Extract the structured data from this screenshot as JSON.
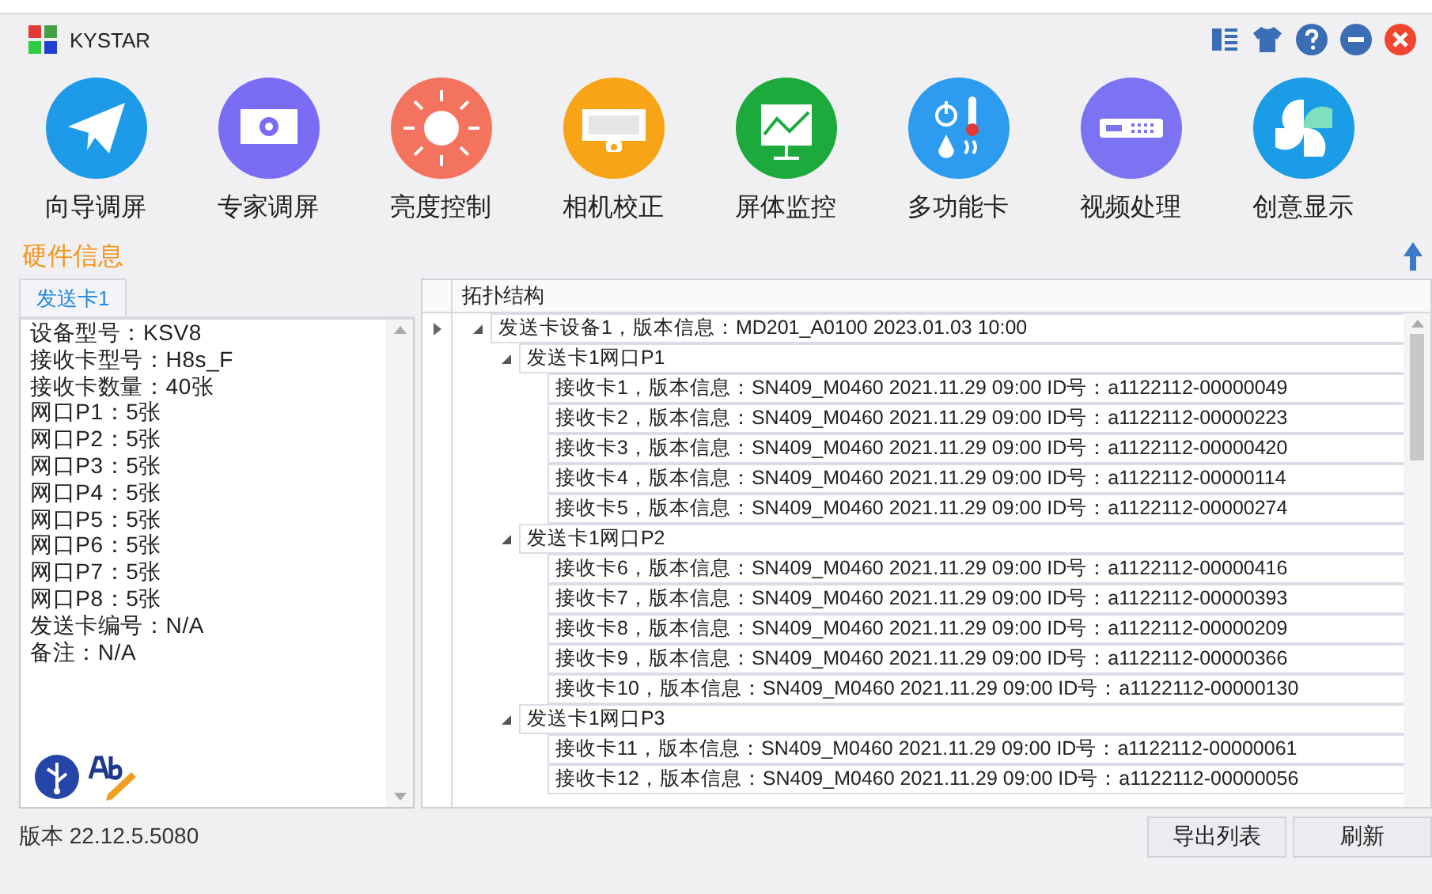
{
  "window": {
    "title": "KYSTAR"
  },
  "toolbar": [
    {
      "label": "向导调屏",
      "kind": "wizard"
    },
    {
      "label": "专家调屏",
      "kind": "expert"
    },
    {
      "label": "亮度控制",
      "kind": "brightness"
    },
    {
      "label": "相机校正",
      "kind": "camera"
    },
    {
      "label": "屏体监控",
      "kind": "monitor"
    },
    {
      "label": "多功能卡",
      "kind": "multi"
    },
    {
      "label": "视频处理",
      "kind": "video"
    },
    {
      "label": "创意显示",
      "kind": "creative"
    }
  ],
  "section_title": "硬件信息",
  "left_panel": {
    "tabs": [
      {
        "label": "发送卡1",
        "selected": true
      }
    ],
    "lines": [
      "设备型号：KSV8",
      "接收卡型号：H8s_F",
      "接收卡数量：40张",
      "网口P1：5张",
      "网口P2：5张",
      "网口P3：5张",
      "网口P4：5张",
      "网口P5：5张",
      "网口P6：5张",
      "网口P7：5张",
      "网口P8：5张",
      "发送卡编号：N/A",
      "备注：N/A"
    ]
  },
  "topology": {
    "header": "拓扑结构",
    "tree": [
      {
        "label": "发送卡设备1，版本信息：MD201_A0100 2023.01.03 10:00",
        "expanded": true,
        "children": [
          {
            "label": "发送卡1网口P1",
            "expanded": true,
            "children": [
              {
                "label": "接收卡1，版本信息：SN409_M0460 2021.11.29 09:00 ID号：a1122112-00000049"
              },
              {
                "label": "接收卡2，版本信息：SN409_M0460 2021.11.29 09:00 ID号：a1122112-00000223"
              },
              {
                "label": "接收卡3，版本信息：SN409_M0460 2021.11.29 09:00 ID号：a1122112-00000420"
              },
              {
                "label": "接收卡4，版本信息：SN409_M0460 2021.11.29 09:00 ID号：a1122112-00000114"
              },
              {
                "label": "接收卡5，版本信息：SN409_M0460 2021.11.29 09:00 ID号：a1122112-00000274"
              }
            ]
          },
          {
            "label": "发送卡1网口P2",
            "expanded": true,
            "children": [
              {
                "label": "接收卡6，版本信息：SN409_M0460 2021.11.29 09:00 ID号：a1122112-00000416"
              },
              {
                "label": "接收卡7，版本信息：SN409_M0460 2021.11.29 09:00 ID号：a1122112-00000393"
              },
              {
                "label": "接收卡8，版本信息：SN409_M0460 2021.11.29 09:00 ID号：a1122112-00000209"
              },
              {
                "label": "接收卡9，版本信息：SN409_M0460 2021.11.29 09:00 ID号：a1122112-00000366"
              },
              {
                "label": "接收卡10，版本信息：SN409_M0460 2021.11.29 09:00 ID号：a1122112-00000130"
              }
            ]
          },
          {
            "label": "发送卡1网口P3",
            "expanded": true,
            "children": [
              {
                "label": "接收卡11，版本信息：SN409_M0460 2021.11.29 09:00 ID号：a1122112-00000061"
              },
              {
                "label": "接收卡12，版本信息：SN409_M0460 2021.11.29 09:00 ID号：a1122112-00000056"
              }
            ]
          }
        ]
      }
    ]
  },
  "status_bar": {
    "version": "版本 22.12.5.5080",
    "buttons": [
      "导出列表",
      "刷新"
    ]
  }
}
